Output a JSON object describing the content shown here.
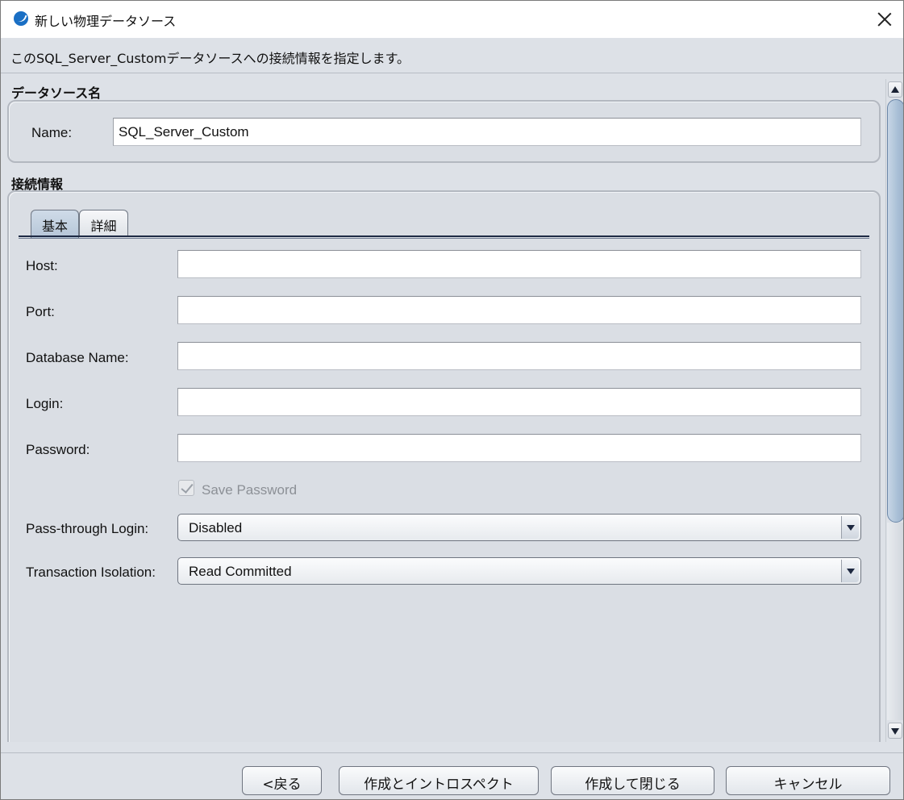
{
  "window": {
    "title": "新しい物理データソース",
    "info": "このSQL_Server_Customデータソースへの接続情報を指定します。"
  },
  "datasource_section": {
    "title": "データソース名",
    "name_label": "Name:",
    "name_value": "SQL_Server_Custom"
  },
  "connection_section": {
    "title": "接続情報",
    "tabs": [
      {
        "label": "基本",
        "active": true
      },
      {
        "label": "詳細",
        "active": false
      }
    ],
    "fields": {
      "host_label": "Host:",
      "host_value": "",
      "port_label": "Port:",
      "port_value": "",
      "database_label": "Database Name:",
      "database_value": "",
      "login_label": "Login:",
      "login_value": "",
      "password_label": "Password:",
      "password_value": ""
    },
    "save_password": {
      "label": "Save Password",
      "checked": true,
      "enabled": false
    },
    "pass_through": {
      "label": "Pass-through Login:",
      "value": "Disabled"
    },
    "isolation": {
      "label": "Transaction Isolation:",
      "value": "Read Committed"
    }
  },
  "footer": {
    "back": "<戻る",
    "create_introspect": "作成とイントロスペクト",
    "create_close": "作成して閉じる",
    "cancel": "キャンセル"
  }
}
